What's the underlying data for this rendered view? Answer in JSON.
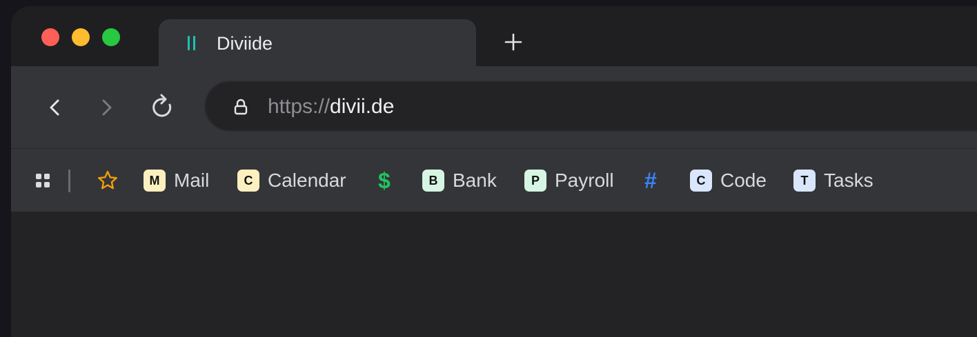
{
  "tab": {
    "title": "Diviide"
  },
  "address_bar": {
    "scheme": "https://",
    "host": "divii.de"
  },
  "bookmarks": [
    {
      "badge": "M",
      "label": "Mail",
      "color": "#fdf0c0"
    },
    {
      "badge": "C",
      "label": "Calendar",
      "color": "#fdf0c0"
    },
    {
      "symbol": "$",
      "label": "",
      "color": "#22c55e"
    },
    {
      "badge": "B",
      "label": "Bank",
      "color": "#d6f5e3"
    },
    {
      "badge": "P",
      "label": "Payroll",
      "color": "#d6f5e3"
    },
    {
      "symbol": "#",
      "label": "",
      "color": "#3b82f6"
    },
    {
      "badge": "C",
      "label": "Code",
      "color": "#d9e6fb"
    },
    {
      "badge": "T",
      "label": "Tasks",
      "color": "#d9e6fb"
    }
  ],
  "icons": {
    "favicon": "divider-bars-icon",
    "new_tab": "plus-icon",
    "back": "chevron-left-icon",
    "forward": "chevron-right-icon",
    "reload": "reload-icon",
    "lock": "lock-icon",
    "apps": "apps-grid-icon",
    "star": "star-icon"
  },
  "colors": {
    "favicon": "#19c2b4",
    "star": "#f59e0b",
    "traffic_close": "#ff5f57",
    "traffic_minimize": "#febc2e",
    "traffic_zoom": "#28c840"
  }
}
